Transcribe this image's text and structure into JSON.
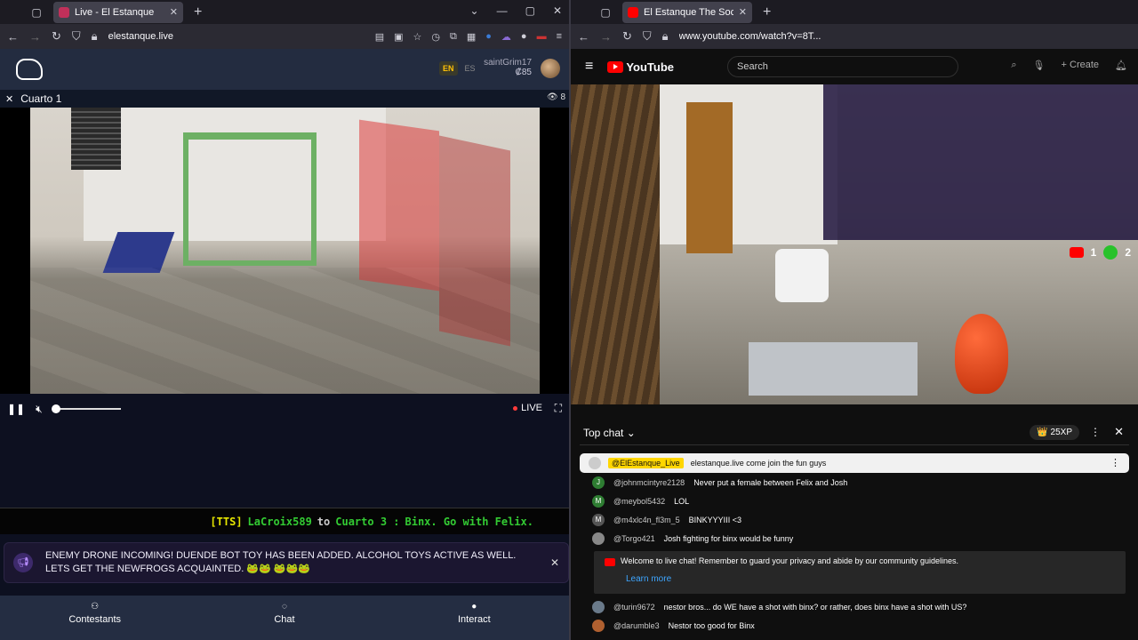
{
  "left_browser": {
    "tab_title": "Live - El Estanque",
    "url": "elestanque.live"
  },
  "right_browser": {
    "tab_title": "El Estanque The Social Expe",
    "url": "www.youtube.com/watch?v=8T..."
  },
  "app": {
    "lang_en": "EN",
    "lang_es": "ES",
    "username": "saintGrim17",
    "points": "₡85",
    "room_title": "Cuarto 1",
    "viewer_count": "8",
    "live_label": "LIVE",
    "ticker": {
      "tag": "[TTS]",
      "user": "LaCroix589",
      "to": "to",
      "room": "Cuarto 3 :",
      "text": "Binx. Go with Felix."
    },
    "notice": "ENEMY DRONE INCOMING! DUENDE BOT TOY HAS BEEN ADDED. ALCOHOL TOYS ACTIVE AS WELL. LETS GET THE NEWFROGS ACQUAINTED. 🐸🐸 🐸🐸🐸",
    "nav": [
      {
        "label": "Contestants"
      },
      {
        "label": "Chat"
      },
      {
        "label": "Interact"
      }
    ]
  },
  "youtube": {
    "logo_text": "YouTube",
    "search_placeholder": "Search",
    "create_label": "Create",
    "yt_count": "1",
    "xbox_count": "2",
    "chat": {
      "title": "Top chat",
      "xp": "25XP",
      "pinned_author": "@ElEstanque_Live",
      "pinned_text": "elestanque.live come join the fun guys",
      "messages": [
        {
          "initial": "J",
          "color": "#2e7d32",
          "author": "@johnmcintyre2128",
          "text": "Never put a female between Felix and Josh"
        },
        {
          "initial": "M",
          "color": "#2e7d32",
          "author": "@meybol5432",
          "text": "LOL"
        },
        {
          "initial": "M",
          "color": "#555555",
          "author": "@m4xlc4n_fl3m_5",
          "text": "BINKYYYIII <3"
        },
        {
          "initial": "",
          "color": "#888888",
          "author": "@Torgo421",
          "text": "Josh fighting for binx would be funny"
        }
      ],
      "guidelines": "Welcome to live chat! Remember to guard your privacy and abide by our community guidelines.",
      "learn_more": "Learn more",
      "messages2": [
        {
          "initial": "",
          "color": "#6a7a8a",
          "author": "@turin9672",
          "text": "nestor bros... do WE have a shot with binx? or rather, does binx have a shot with US?"
        },
        {
          "initial": "",
          "color": "#b06030",
          "author": "@darumble3",
          "text": "Nestor too good for Binx"
        }
      ]
    }
  }
}
